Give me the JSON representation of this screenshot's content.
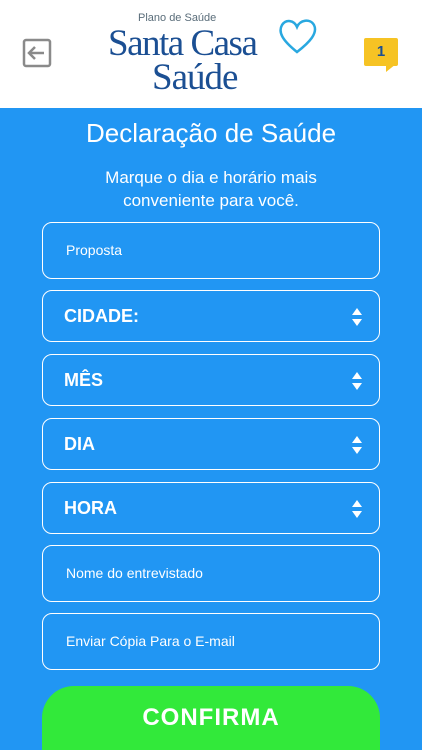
{
  "header": {
    "logo_small": "Plano de Saúde",
    "logo_line1": "Santa Casa",
    "logo_line2": "Saúde",
    "notification_count": "1"
  },
  "page": {
    "title": "Declaração de Saúde",
    "subtitle": "Marque o dia e horário mais conveniente para você."
  },
  "form": {
    "proposta_placeholder": "Proposta",
    "cidade_label": "CIDADE:",
    "mes_label": "MÊS",
    "dia_label": "DIA",
    "hora_label": "HORA",
    "entrevistado_placeholder": "Nome do entrevistado",
    "email_placeholder": "Enviar Cópia Para o E-mail",
    "confirm_label": "CONFIRMA"
  },
  "colors": {
    "background": "#2196F3",
    "logo_blue": "#1b4f93",
    "badge_yellow": "#f6c324",
    "confirm_green": "#32e93a"
  }
}
